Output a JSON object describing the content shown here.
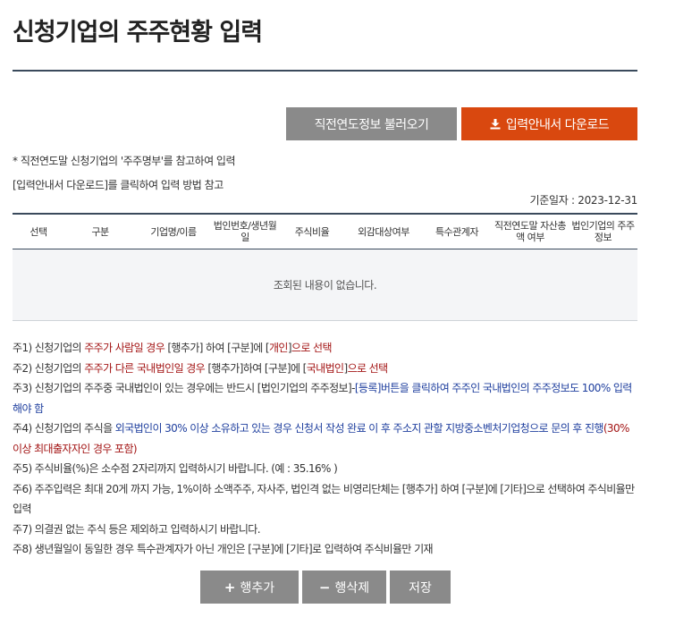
{
  "page_title": "신청기업의 주주현황 입력",
  "buttons": {
    "load_prev": "직전연도정보 불러오기",
    "download_guide": "입력안내서 다운로드",
    "add_row": "행추가",
    "delete_row": "행삭제",
    "save": "저장"
  },
  "notes_top": [
    "* 직전연도말 신청기업의 '주주명부'를 참고하여 입력",
    "[입력안내서 다운로드]를 클릭하여 입력 방법 참고"
  ],
  "std_date": "기준일자 : 2023-12-31",
  "table": {
    "headers": [
      "선택",
      "구분",
      "기업명/이름",
      "법인번호/생년월일",
      "주식비율",
      "외감대상여부",
      "특수관계자",
      "직전연도말 자산총액 여부",
      "법인기업의 주주정보"
    ],
    "empty_message": "조회된 내용이 없습니다."
  },
  "footnotes": {
    "n1": {
      "a": "주1) 신청기업의 ",
      "b": "주주가 사람일 경우",
      "c": " [행추가] 하여 [구분]에 [",
      "d": "개인",
      "e": "]",
      "f": "으로 선택"
    },
    "n2": {
      "a": "주2) 신청기업의 ",
      "b": "주주가 다른 국내법인일 경우",
      "c": " [행추가]하여 [구분]에 [",
      "d": "국내법인",
      "e": "]",
      "f": "으로 선택"
    },
    "n3": {
      "a": "주3) 신청기업의 주주중 국내법인이 있는 경우에는 반드시 [법인기업의 주주정보]-",
      "b": "[등록]버튼을 클릭하여 주주인 국내법인의 주주정보도 100% 입력해야 함"
    },
    "n4": {
      "a": "주4) 신청기업의 주식을 ",
      "b": "외국법인이 30% 이상 소유하고 있는 경우 신청서 작성 완료 이 후 주소지 관할 지방중소벤처기업청으로 문의 후 진행",
      "c": "(30%이상 최대출자자인 경우 포함)"
    },
    "n5": "주5) 주식비율(%)은 소수점 2자리까지 입력하시기 바랍니다. (예 : 35.16% )",
    "n6": "주6) 주주입력은 최대 20게 까지 가능, 1%이하 소액주주, 자사주, 법인격 없는 비영리단체는 [행추가] 하여 [구분]에 [기타]으로 선택하여 주식비율만 입력",
    "n7": "주7) 의결권 없는 주식 등은 제외하고 입력하시기 바랍니다.",
    "n8": "주8) 생년월일이 동일한 경우 특수관계자가 아닌 개인은 [구분]에 [기타]로 입력하여 주식비율만 기재"
  },
  "colors": {
    "accent": "#d9480f",
    "gray_button": "#8a8a8a",
    "rule": "#3a4a5c",
    "red_text": "#a31515",
    "blue_text": "#1f3f9e"
  },
  "icons": [
    "download-icon",
    "plus-icon",
    "minus-icon"
  ]
}
